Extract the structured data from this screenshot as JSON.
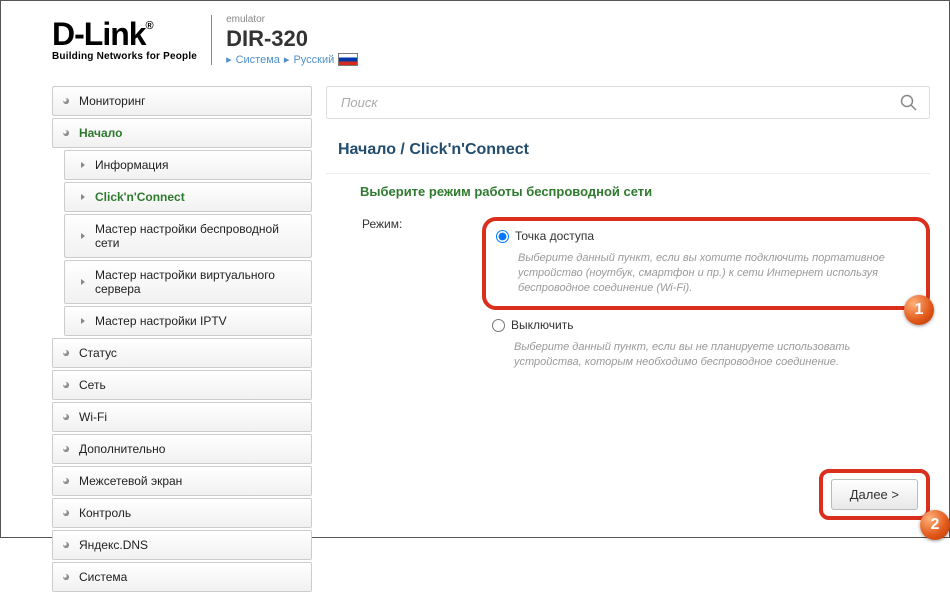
{
  "brand": {
    "name": "D-Link",
    "reg": "®",
    "tag": "Building Networks for People"
  },
  "header": {
    "emul": "emulator",
    "model": "DIR-320"
  },
  "topcrumbs": {
    "system": "Система",
    "lang": "Русский"
  },
  "sidebar": {
    "items": [
      {
        "label": "Мониторинг"
      },
      {
        "label": "Начало"
      },
      {
        "label": "Статус"
      },
      {
        "label": "Сеть"
      },
      {
        "label": "Wi-Fi"
      },
      {
        "label": "Дополнительно"
      },
      {
        "label": "Межсетевой экран"
      },
      {
        "label": "Контроль"
      },
      {
        "label": "Яндекс.DNS"
      },
      {
        "label": "Система"
      }
    ],
    "subs": [
      {
        "label": "Информация"
      },
      {
        "label": "Click'n'Connect"
      },
      {
        "label": "Мастер настройки беспроводной сети"
      },
      {
        "label": "Мастер настройки виртуального сервера"
      },
      {
        "label": "Мастер настройки IPTV"
      }
    ]
  },
  "search": {
    "placeholder": "Поиск"
  },
  "breadcrumb": {
    "a": "Начало",
    "sep": "/",
    "b": "Click'n'Connect"
  },
  "panel": {
    "subtitle": "Выберите режим работы беспроводной сети",
    "mode_label": "Режим:",
    "opt1": {
      "title": "Точка доступа",
      "desc": "Выберите данный пункт, если вы хотите подключить портативное устройство (ноутбук, смартфон и пр.) к сети Интернет используя беспроводное соединение (Wi-Fi)."
    },
    "opt2": {
      "title": "Выключить",
      "desc": "Выберите данный пункт, если вы не планируете использовать устройства, которым необходимо беспроводное соединение."
    }
  },
  "footer": {
    "next": "Далее >"
  },
  "annotations": {
    "one": "1",
    "two": "2"
  }
}
